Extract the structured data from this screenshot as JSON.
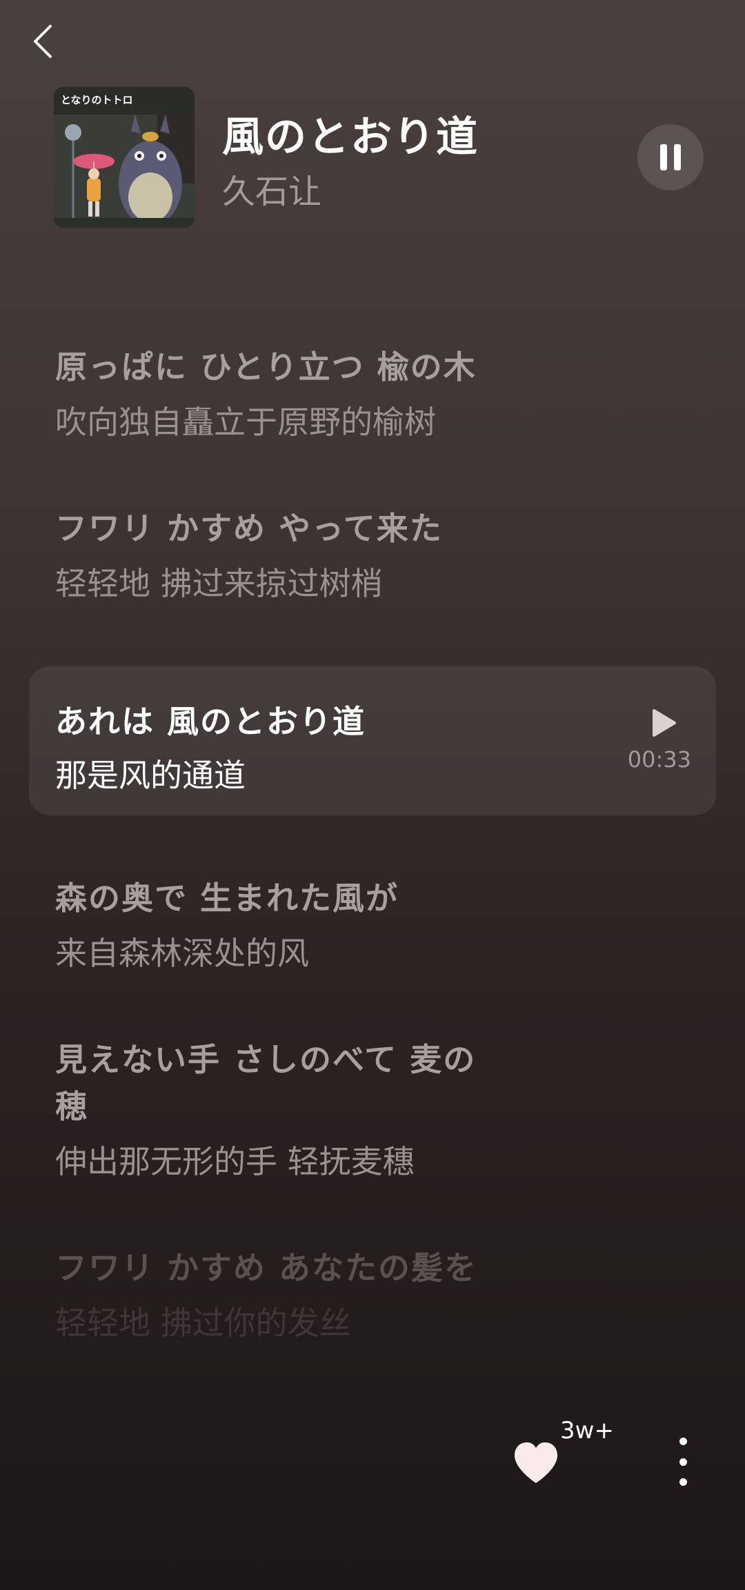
{
  "header": {
    "title": "風のとおり道",
    "artist": "久石让",
    "album_art_text": "となりのトトロ"
  },
  "lyrics": [
    {
      "jp": "原っぱに ひとり立つ 楡の木",
      "cn": "吹向独自矗立于原野的榆树",
      "state": "normal"
    },
    {
      "jp": "フワリ かすめ やって来た",
      "cn": "轻轻地 拂过来掠过树梢",
      "state": "normal"
    },
    {
      "jp": "あれは 風のとおり道",
      "cn": "那是风的通道",
      "state": "active",
      "time": "00:33"
    },
    {
      "jp": "森の奥で 生まれた風が",
      "cn": "来自森林深处的风",
      "state": "normal"
    },
    {
      "jp": "見えない手 さしのべて 麦の穂",
      "cn": "伸出那无形的手 轻抚麦穗",
      "state": "normal"
    },
    {
      "jp": "フワリ かすめ あなたの髪を",
      "cn": "轻轻地 拂过你的发丝",
      "state": "fade"
    }
  ],
  "footer": {
    "like_count": "3w+"
  }
}
